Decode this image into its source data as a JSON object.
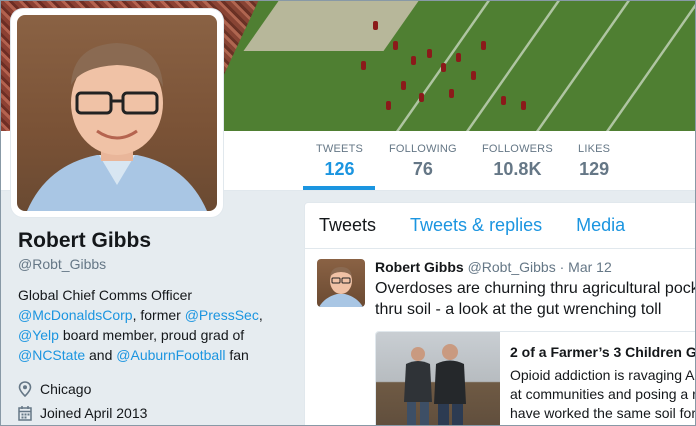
{
  "nav": {
    "stats": [
      {
        "label": "TWEETS",
        "value": "126",
        "active": true
      },
      {
        "label": "FOLLOWING",
        "value": "76",
        "active": false
      },
      {
        "label": "FOLLOWERS",
        "value": "10.8K",
        "active": false
      },
      {
        "label": "LIKES",
        "value": "129",
        "active": false
      }
    ]
  },
  "profile": {
    "name": "Robert Gibbs",
    "handle": "@Robt_Gibbs",
    "bio": {
      "line1": "Global Chief Comms Officer",
      "mention_mcd": "@McDonaldsCorp",
      "text_former": ", former ",
      "mention_presssec": "@PressSec",
      "text_comma": ",",
      "mention_yelp": "@Yelp",
      "text_board": " board member, proud grad of",
      "mention_ncstate": "@NCState",
      "text_and": " and ",
      "mention_auburn": "@AuburnFootball",
      "text_fan": " fan"
    },
    "location": "Chicago",
    "joined": "Joined April 2013",
    "location_icon": "map-pin-icon",
    "joined_icon": "calendar-icon"
  },
  "timeline": {
    "tabs": [
      "Tweets",
      "Tweets & replies",
      "Media"
    ],
    "tweet": {
      "name": "Robert Gibbs",
      "handle": "@Robt_Gibbs",
      "sep": " · ",
      "date": "Mar 12",
      "text_line1": "Overdoses are churning thru agricultural pock",
      "text_line2": "thru soil - a look at the gut wrenching toll",
      "card": {
        "title": "2 of a Farmer’s 3 Children G",
        "desc_line1": "Opioid addiction is ravaging A",
        "desc_line2": "at communities and posing a r",
        "desc_line3": "have worked the same soil for"
      }
    }
  },
  "colors": {
    "accent": "#1b95e0",
    "text": "#14171a",
    "muted": "#657786",
    "background": "#e6ecf0"
  }
}
